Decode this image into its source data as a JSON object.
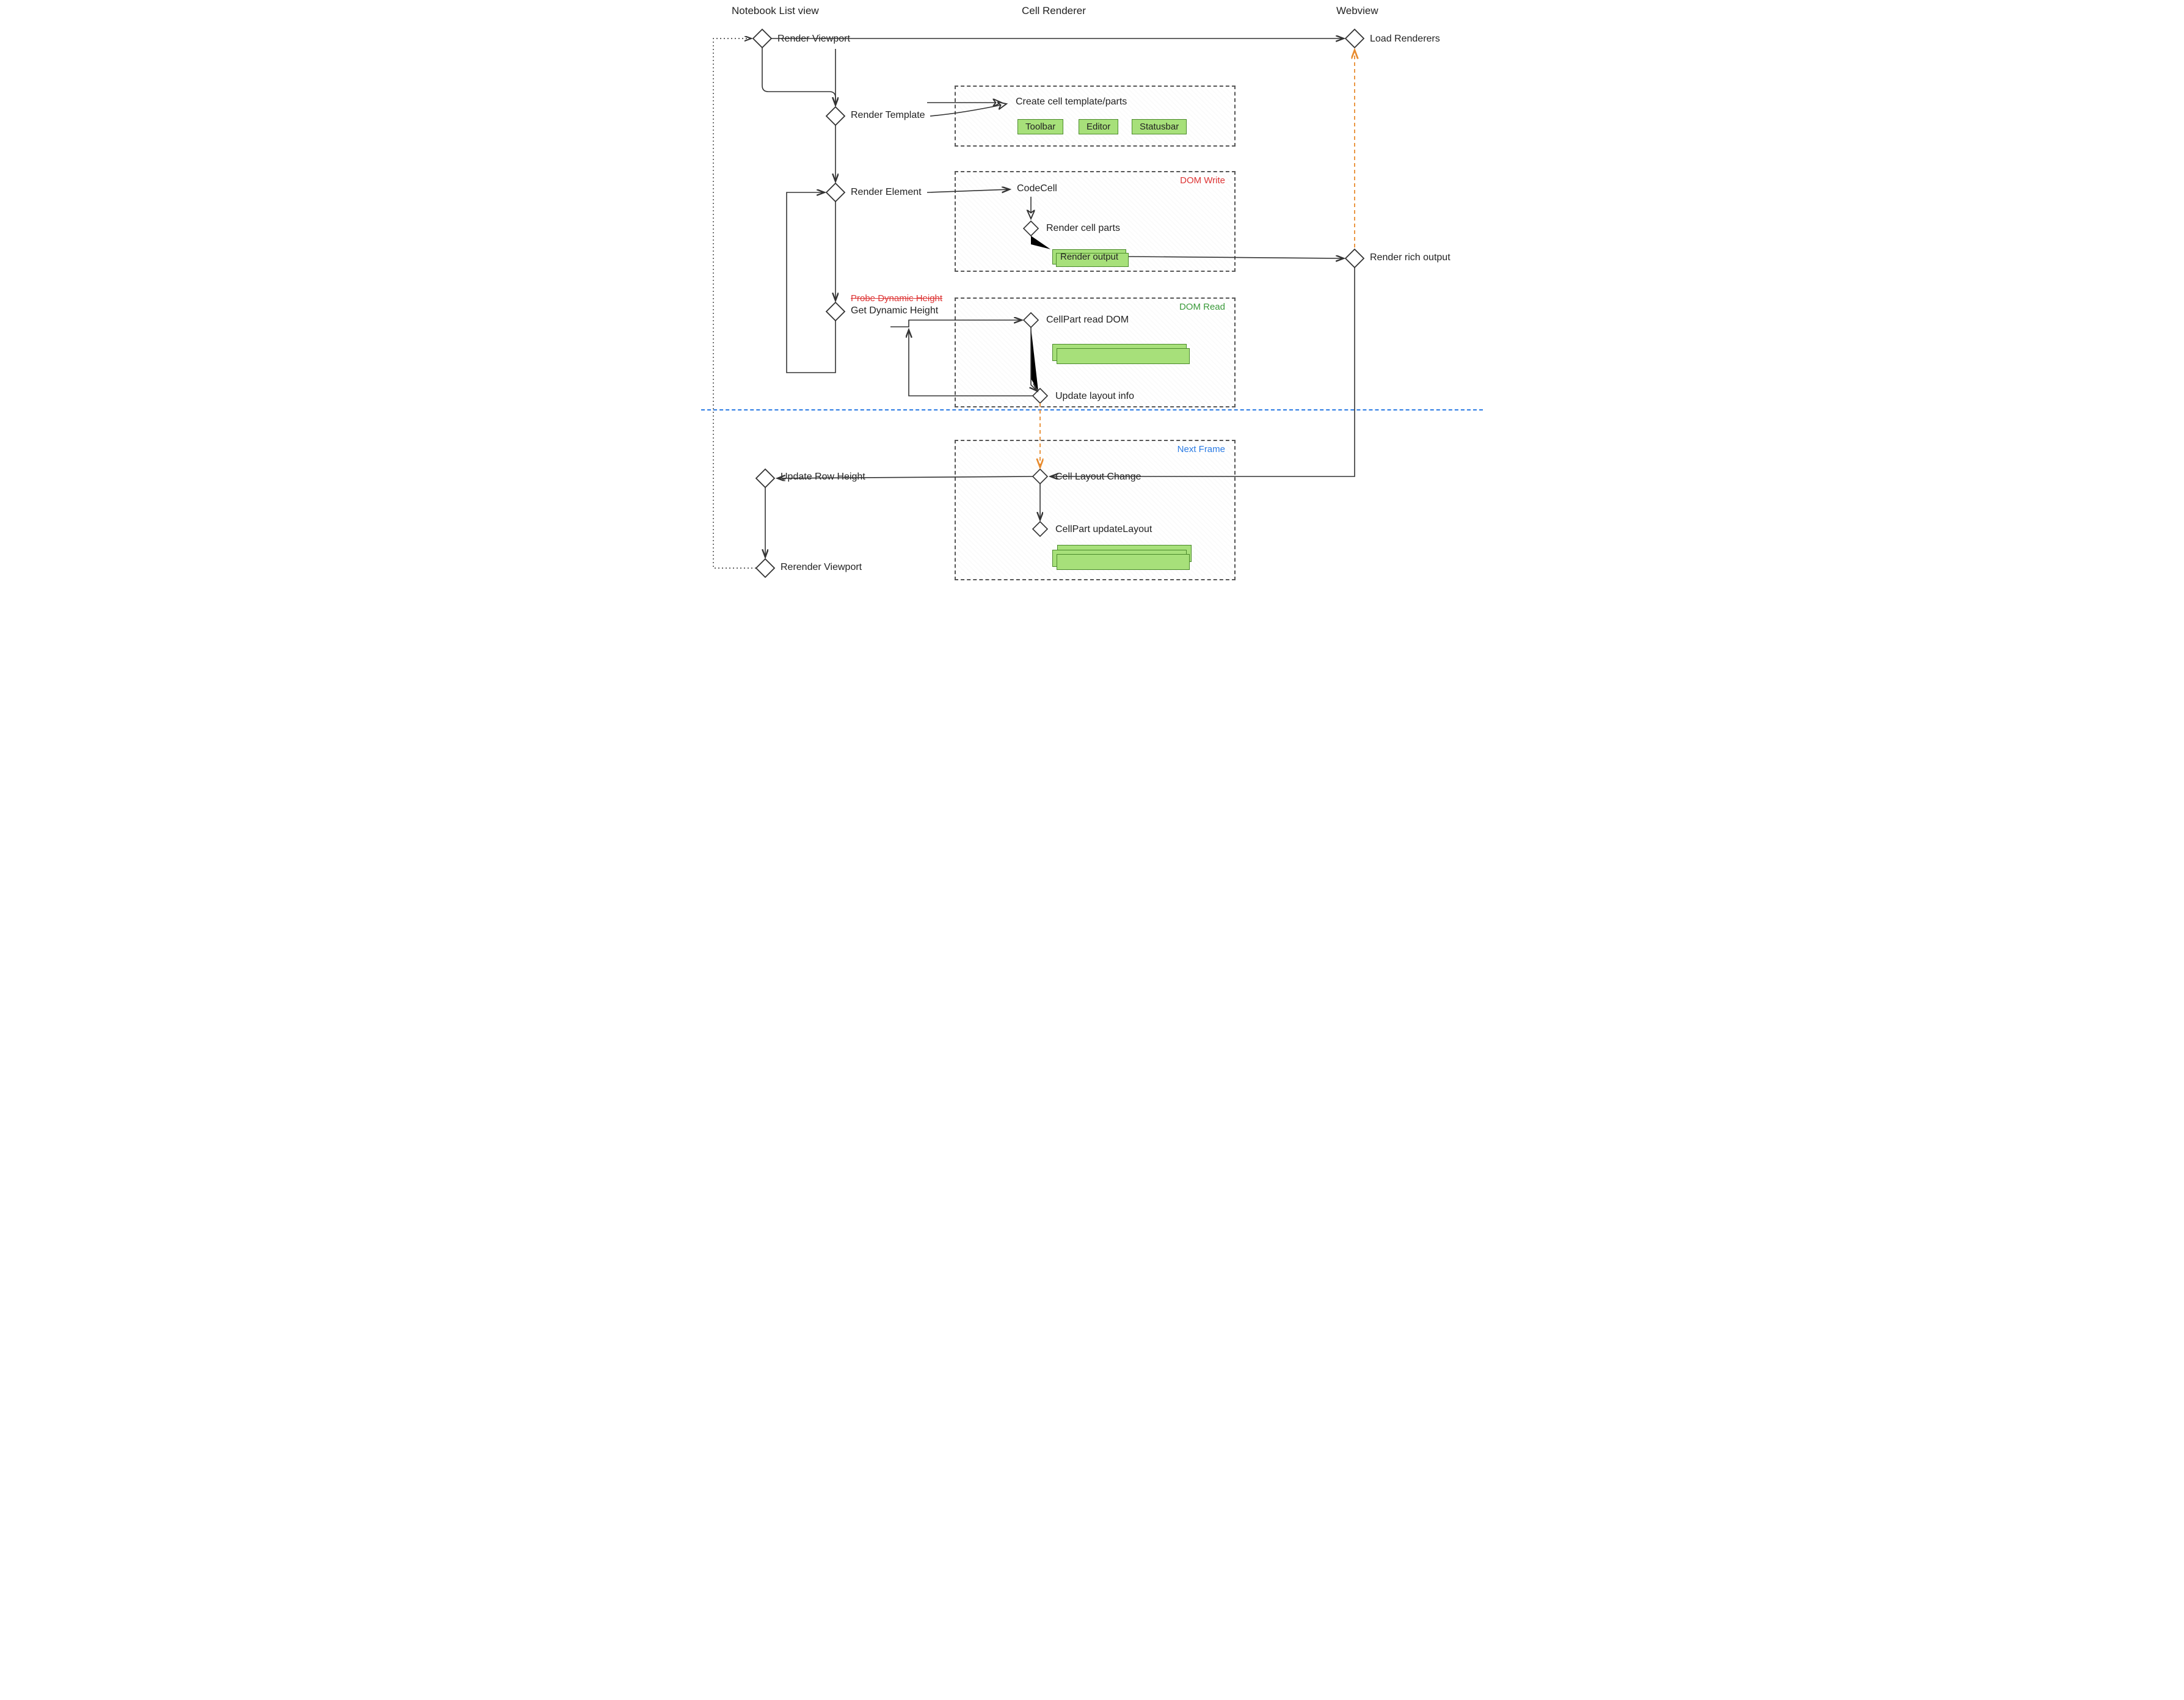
{
  "headers": {
    "listview": "Notebook List view",
    "renderer": "Cell Renderer",
    "webview": "Webview"
  },
  "nodes": {
    "render_viewport": "Render Viewport",
    "load_renderers": "Load Renderers",
    "render_template": "Render Template",
    "create_template": "Create cell template/parts",
    "render_element": "Render Element",
    "codecell": "CodeCell",
    "render_cell_parts": "Render cell parts",
    "render_output": "Render output",
    "render_rich_output": "Render rich output",
    "probe_dynamic": "Probe Dynamic Height",
    "get_dynamic": "Get Dynamic Height",
    "cellpart_read": "CellPart read DOM",
    "update_layout_info": "Update layout info",
    "cell_layout_change": "Cell Layout Change",
    "cellpart_update": "CellPart updateLayout",
    "update_row_height": "Update Row Height",
    "rerender_viewport": "Rerender Viewport"
  },
  "chips": {
    "toolbar": "Toolbar",
    "editor": "Editor",
    "statusbar": "Statusbar"
  },
  "panels": {
    "dom_write": "DOM Write",
    "dom_read": "DOM Read",
    "next_frame": "Next Frame"
  },
  "colors": {
    "dom_write": "#d33",
    "dom_read": "#3a9a3a",
    "next_frame": "#2b7be4",
    "orange": "#e88b2e",
    "green_fill": "#a7e07a",
    "green_border": "#4a8a2a"
  }
}
